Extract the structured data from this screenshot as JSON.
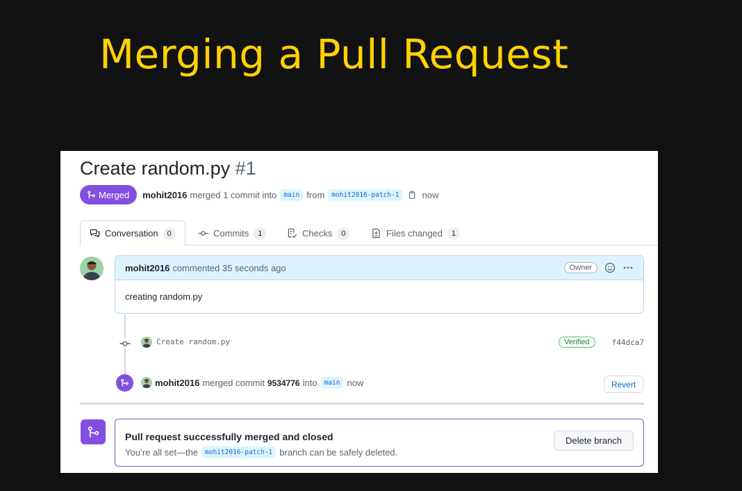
{
  "slide": {
    "title": "Merging a Pull Request"
  },
  "pr": {
    "title": "Create random.py",
    "number": "#1",
    "status_label": "Merged",
    "author": "mohit2016",
    "merge_text": "merged 1 commit into",
    "base_branch": "main",
    "from_text": "from",
    "head_branch": "mohit2016-patch-1",
    "time": "now"
  },
  "tabs": [
    {
      "label": "Conversation",
      "count": "0",
      "icon": "comment-discussion-icon"
    },
    {
      "label": "Commits",
      "count": "1",
      "icon": "commit-icon"
    },
    {
      "label": "Checks",
      "count": "0",
      "icon": "checklist-icon"
    },
    {
      "label": "Files changed",
      "count": "1",
      "icon": "file-diff-icon"
    }
  ],
  "comment": {
    "author": "mohit2016",
    "meta": "commented 35 seconds ago",
    "role_badge": "Owner",
    "body": "creating random.py"
  },
  "commit_event": {
    "message": "Create random.py",
    "verified_label": "Verified",
    "sha": "f44dca7"
  },
  "merge_event": {
    "author": "mohit2016",
    "text": "merged commit",
    "commit_sha": "9534776",
    "into_text": "into",
    "branch": "main",
    "time": "now",
    "revert_label": "Revert"
  },
  "merged_box": {
    "heading": "Pull request successfully merged and closed",
    "prefix": "You’re all set—the",
    "branch": "mohit2016-patch-1",
    "suffix": "branch can be safely deleted.",
    "delete_label": "Delete branch"
  },
  "colors": {
    "slide_title": "#ffd200",
    "merged_purple": "#8250df",
    "link_blue": "#0969da",
    "verified_green": "#1a7f37"
  }
}
